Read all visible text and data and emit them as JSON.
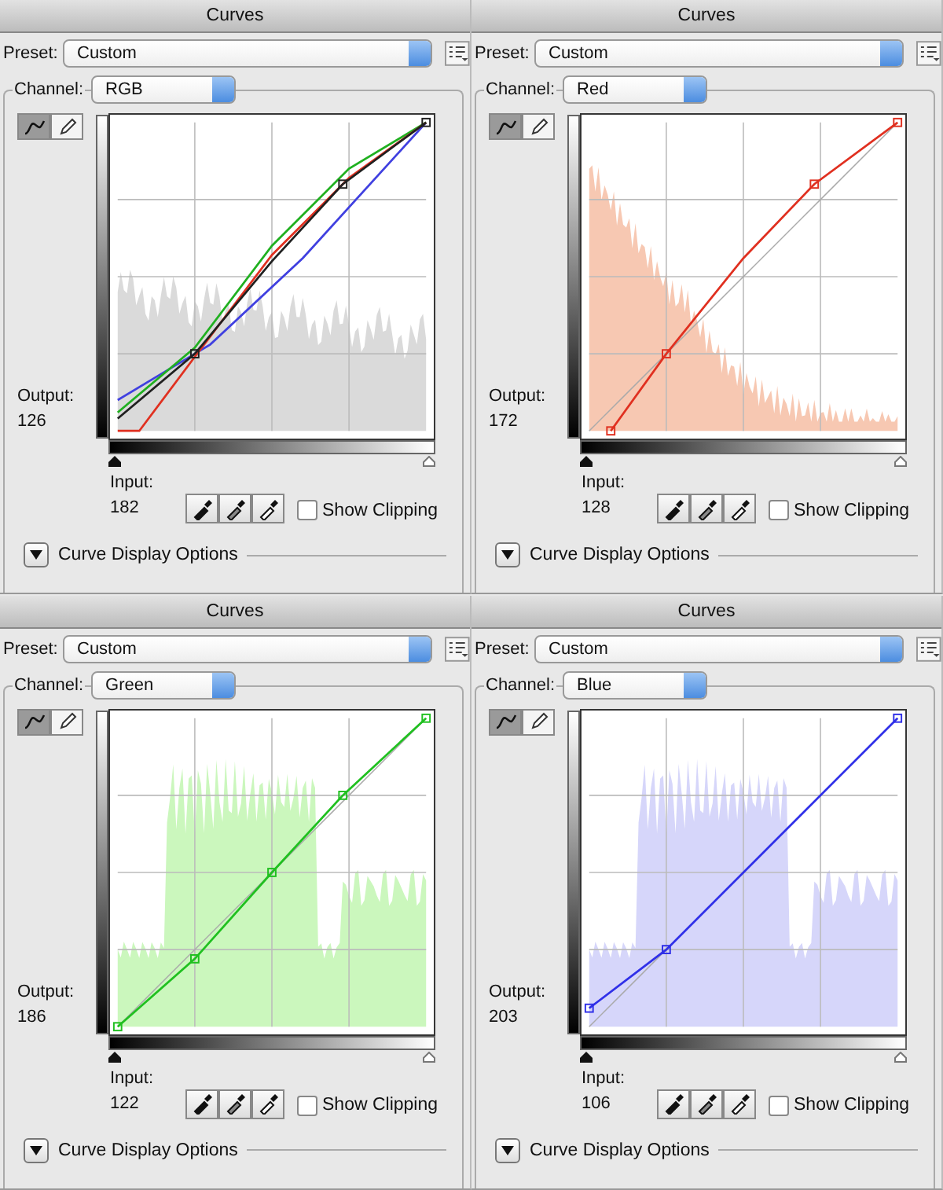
{
  "panels": [
    {
      "title": "Curves",
      "preset_label": "Preset:",
      "preset": "Custom",
      "channel_label": "Channel:",
      "channel": "RGB",
      "tools": [
        {
          "kind": "curve",
          "selected": true
        },
        {
          "kind": "pencil",
          "selected": false
        }
      ],
      "histogram": {
        "color": "#dadada"
      },
      "curves": [
        {
          "kind": "blue",
          "color": "#4040e0"
        },
        {
          "kind": "green",
          "color": "#20b020"
        },
        {
          "kind": "red",
          "color": "#e03020"
        },
        {
          "kind": "composite",
          "color": "#202020"
        }
      ],
      "output_label": "Output:",
      "output": "126",
      "input_label": "Input:",
      "input": "182",
      "show_clipping": {
        "label": "Show Clipping",
        "checked": false
      },
      "display_options": "Curve Display Options"
    },
    {
      "title": "Curves",
      "preset_label": "Preset:",
      "preset": "Custom",
      "channel_label": "Channel:",
      "channel": "Red",
      "tools": [
        {
          "kind": "curve",
          "selected": true
        },
        {
          "kind": "pencil",
          "selected": false
        }
      ],
      "histogram": {
        "color": "#f7c8b2"
      },
      "curves": [
        {
          "kind": "red",
          "color": "#e03020"
        }
      ],
      "output_label": "Output:",
      "output": "172",
      "input_label": "Input:",
      "input": "128",
      "show_clipping": {
        "label": "Show Clipping",
        "checked": false
      },
      "display_options": "Curve Display Options"
    },
    {
      "title": "Curves",
      "preset_label": "Preset:",
      "preset": "Custom",
      "channel_label": "Channel:",
      "channel": "Green",
      "tools": [
        {
          "kind": "curve",
          "selected": true
        },
        {
          "kind": "pencil",
          "selected": false
        }
      ],
      "histogram": {
        "color": "#cbf7bd"
      },
      "curves": [
        {
          "kind": "green",
          "color": "#20c020"
        }
      ],
      "output_label": "Output:",
      "output": "186",
      "input_label": "Input:",
      "input": "122",
      "show_clipping": {
        "label": "Show Clipping",
        "checked": false
      },
      "display_options": "Curve Display Options"
    },
    {
      "title": "Curves",
      "preset_label": "Preset:",
      "preset": "Custom",
      "channel_label": "Channel:",
      "channel": "Blue",
      "tools": [
        {
          "kind": "curve",
          "selected": true
        },
        {
          "kind": "pencil",
          "selected": false
        }
      ],
      "histogram": {
        "color": "#d6d6fa"
      },
      "curves": [
        {
          "kind": "blue",
          "color": "#3030e8"
        }
      ],
      "output_label": "Output:",
      "output": "203",
      "input_label": "Input:",
      "input": "106",
      "show_clipping": {
        "label": "Show Clipping",
        "checked": false
      },
      "display_options": "Curve Display Options"
    }
  ]
}
